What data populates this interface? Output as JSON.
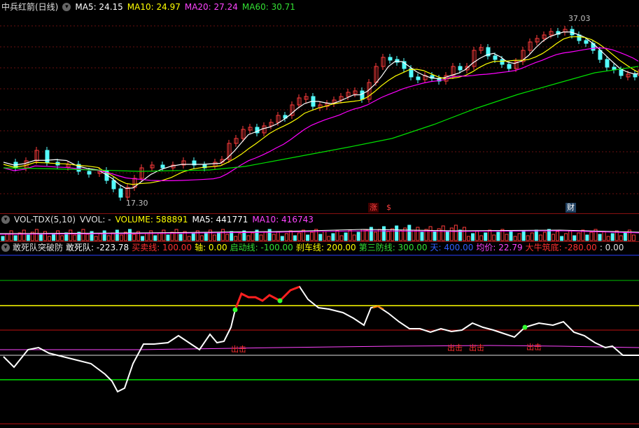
{
  "main": {
    "title": "中兵红箭(日线)",
    "ma5_label": "MA5: 24.15",
    "ma10_label": "MA10: 24.97",
    "ma20_label": "MA20: 27.24",
    "ma60_label": "MA60: 30.71",
    "high_label": "37.03",
    "low_label": "17.30",
    "markers": [
      "涨",
      "$",
      "财"
    ]
  },
  "volume": {
    "title": "VOL-TDX(5,10)",
    "vvol_label": "VVOL: -",
    "volume_label": "VOLUME: 588891",
    "ma5_label": "MA5: 441771",
    "ma10_label": "MA10: 416743"
  },
  "indicator": {
    "title": "敢死队突破防",
    "value_label": "敢死队: -223.78",
    "buy_label": "买卖线: 100.00",
    "axis_label": "轴: 0.00",
    "start_label": "启动线: -100.00",
    "brake_label": "刹车线: 200.00",
    "third_label": "第三防线: 300.00",
    "sky_label": "天: 400.00",
    "avg_label": "均价: 22.79",
    "bull_label": "大牛筑底: -280.00",
    "tail_label": ": 0.00",
    "exit_labels": [
      "出击",
      "出击",
      "出击",
      "出击"
    ]
  },
  "colors": {
    "up": "#ff3b3b",
    "down": "#54fcfc",
    "ma5": "#ffffff",
    "ma10": "#ffff00",
    "ma20": "#ff00ff",
    "ma60": "#00e000"
  }
}
